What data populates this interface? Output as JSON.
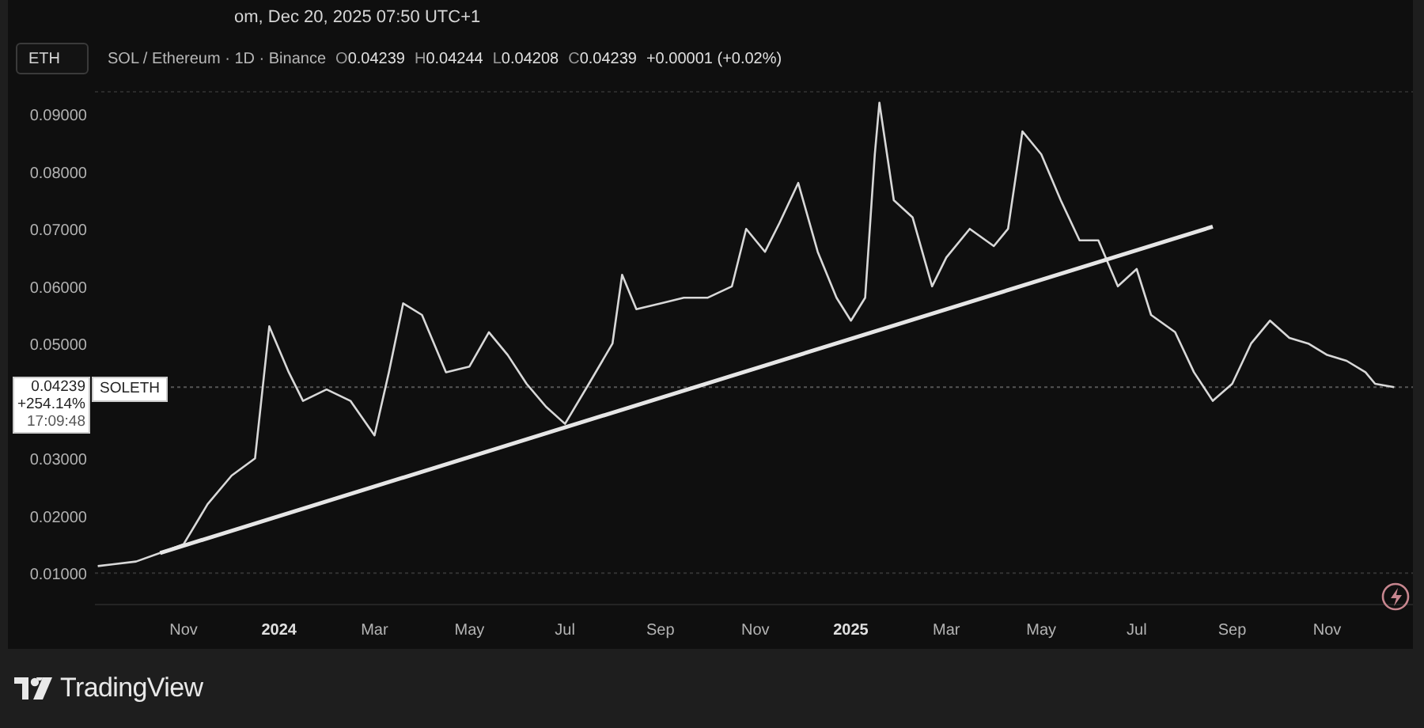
{
  "header": {
    "caption": "om, Dec 20, 2025 07:50 UTC+1",
    "symbol_button": "ETH",
    "symbol_line": "SOL / Ethereum · 1D · Binance",
    "ohlc": [
      {
        "label": "O",
        "value": "0.04239"
      },
      {
        "label": "H",
        "value": "0.04244"
      },
      {
        "label": "L",
        "value": "0.04208"
      },
      {
        "label": "C",
        "value": "0.04239"
      }
    ],
    "change": "+0.00001 (+0.02%)"
  },
  "price_tag": {
    "price": "0.04239",
    "percent": "+254.14%",
    "countdown": "17:09:48"
  },
  "chart": {
    "chart_data": {
      "type": "line",
      "x": [
        2023.683,
        2023.708,
        2023.75,
        2023.792,
        2023.833,
        2023.875,
        2023.917,
        2023.958,
        2023.983,
        2024.017,
        2024.042,
        2024.083,
        2024.125,
        2024.167,
        2024.192,
        2024.217,
        2024.25,
        2024.292,
        2024.333,
        2024.367,
        2024.4,
        2024.433,
        2024.467,
        2024.5,
        2024.542,
        2024.583,
        2024.6,
        2024.625,
        2024.667,
        2024.708,
        2024.75,
        2024.792,
        2024.817,
        2024.85,
        2024.875,
        2024.908,
        2024.942,
        2024.975,
        2025.0,
        2025.025,
        2025.042,
        2025.05,
        2025.075,
        2025.108,
        2025.142,
        2025.167,
        2025.208,
        2025.25,
        2025.275,
        2025.3,
        2025.333,
        2025.367,
        2025.4,
        2025.433,
        2025.467,
        2025.5,
        2025.525,
        2025.567,
        2025.6,
        2025.633,
        2025.667,
        2025.7,
        2025.733,
        2025.767,
        2025.8,
        2025.833,
        2025.867,
        2025.9,
        2025.917,
        2025.95
      ],
      "series": [
        {
          "name": "SOLETH",
          "color": "#d8d8d8",
          "values": [
            0.0112,
            0.0115,
            0.012,
            0.0135,
            0.015,
            0.022,
            0.027,
            0.03,
            0.053,
            0.045,
            0.04,
            0.042,
            0.04,
            0.034,
            0.045,
            0.057,
            0.055,
            0.045,
            0.046,
            0.052,
            0.048,
            0.043,
            0.039,
            0.036,
            0.043,
            0.05,
            0.062,
            0.056,
            0.057,
            0.058,
            0.058,
            0.06,
            0.07,
            0.066,
            0.071,
            0.078,
            0.066,
            0.058,
            0.054,
            0.058,
            0.083,
            0.092,
            0.075,
            0.072,
            0.06,
            0.065,
            0.07,
            0.067,
            0.07,
            0.087,
            0.083,
            0.075,
            0.068,
            0.068,
            0.06,
            0.063,
            0.055,
            0.052,
            0.045,
            0.04,
            0.043,
            0.05,
            0.054,
            0.051,
            0.05,
            0.048,
            0.047,
            0.045,
            0.043,
            0.0424
          ]
        },
        {
          "color": "#e6e6e6",
          "values": [
            null,
            null,
            null,
            0.0135,
            null,
            null,
            null,
            null,
            null,
            null,
            null,
            null,
            null,
            null,
            null,
            null,
            null,
            null,
            null,
            null,
            null,
            null,
            null,
            null,
            null,
            null,
            null,
            null,
            null,
            null,
            null,
            null,
            null,
            null,
            null,
            null,
            null,
            null,
            null,
            null,
            null,
            null,
            null,
            null,
            null,
            null,
            null,
            null,
            null,
            null,
            null,
            null,
            null,
            null,
            null,
            null,
            null,
            null,
            null,
            0.0704,
            null,
            null,
            null,
            null,
            null,
            null,
            null,
            null,
            null,
            null
          ]
        }
      ],
      "xlim": [
        2023.678,
        2025.983
      ],
      "ylim": [
        0.0045,
        0.0939
      ],
      "ref_lines": [
        {
          "value": 0.04239,
          "axis": "y"
        }
      ],
      "xticks": [
        {
          "value": 2023.833,
          "label": "Nov"
        },
        {
          "value": 2024,
          "label": "2024"
        },
        {
          "value": 2024.167,
          "label": "Mar"
        },
        {
          "value": 2024.333,
          "label": "May"
        },
        {
          "value": 2024.5,
          "label": "Jul"
        },
        {
          "value": 2024.667,
          "label": "Sep"
        },
        {
          "value": 2024.833,
          "label": "Nov"
        },
        {
          "value": 2025,
          "label": "2025"
        },
        {
          "value": 2025.167,
          "label": "Mar"
        },
        {
          "value": 2025.333,
          "label": "May"
        },
        {
          "value": 2025.5,
          "label": "Jul"
        },
        {
          "value": 2025.667,
          "label": "Sep"
        },
        {
          "value": 2025.833,
          "label": "Nov"
        }
      ],
      "yticks": [
        {
          "value": 0.09,
          "label": "0.09000"
        },
        {
          "value": 0.08,
          "label": "0.08000"
        },
        {
          "value": 0.07,
          "label": "0.07000"
        },
        {
          "value": 0.06,
          "label": "0.06000"
        },
        {
          "value": 0.05,
          "label": "0.05000"
        },
        {
          "value": 0.03,
          "label": "0.03000"
        },
        {
          "value": 0.02,
          "label": "0.02000"
        },
        {
          "value": 0.01,
          "label": "0.01000"
        }
      ]
    }
  },
  "footer": {
    "brand": "TradingView"
  }
}
